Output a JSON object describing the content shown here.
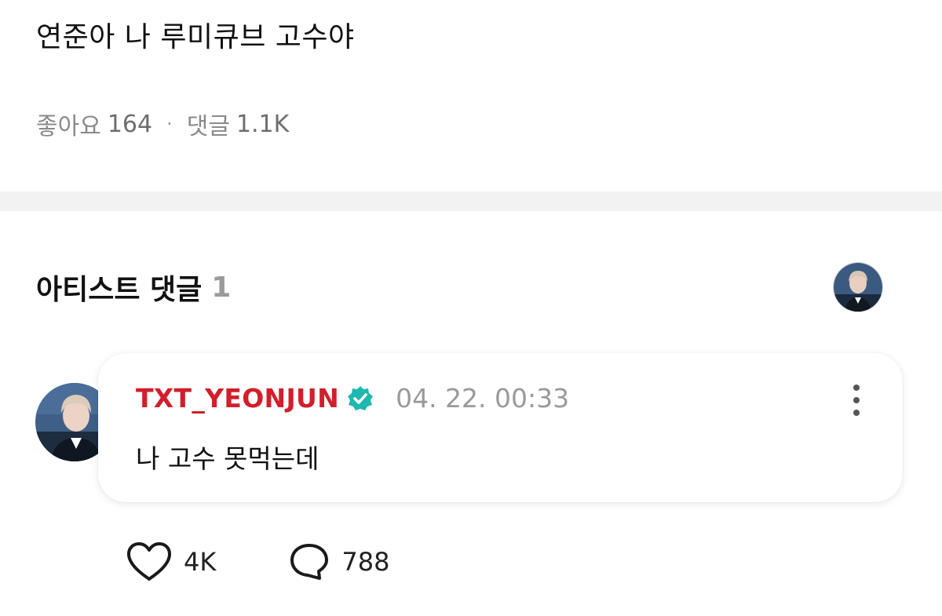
{
  "post": {
    "title": "연준아 나 루미큐브 고수야",
    "likes_label": "좋아요",
    "likes_count": "164",
    "separator": "·",
    "comments_label": "댓글",
    "comments_count": "1.1K"
  },
  "artist_comments": {
    "title": "아티스트 댓글",
    "count": "1"
  },
  "comment": {
    "author": "TXT_YEONJUN",
    "timestamp": "04. 22. 00:33",
    "text": "나 고수 못먹는데",
    "likes": "4K",
    "replies": "788"
  },
  "colors": {
    "author": "#d21f2b",
    "verified_badge": "#1fb8b0",
    "divider": "#f2f2f2"
  },
  "icons": [
    "verified-badge-icon",
    "more-vertical-icon",
    "heart-icon",
    "comment-bubble-icon"
  ]
}
